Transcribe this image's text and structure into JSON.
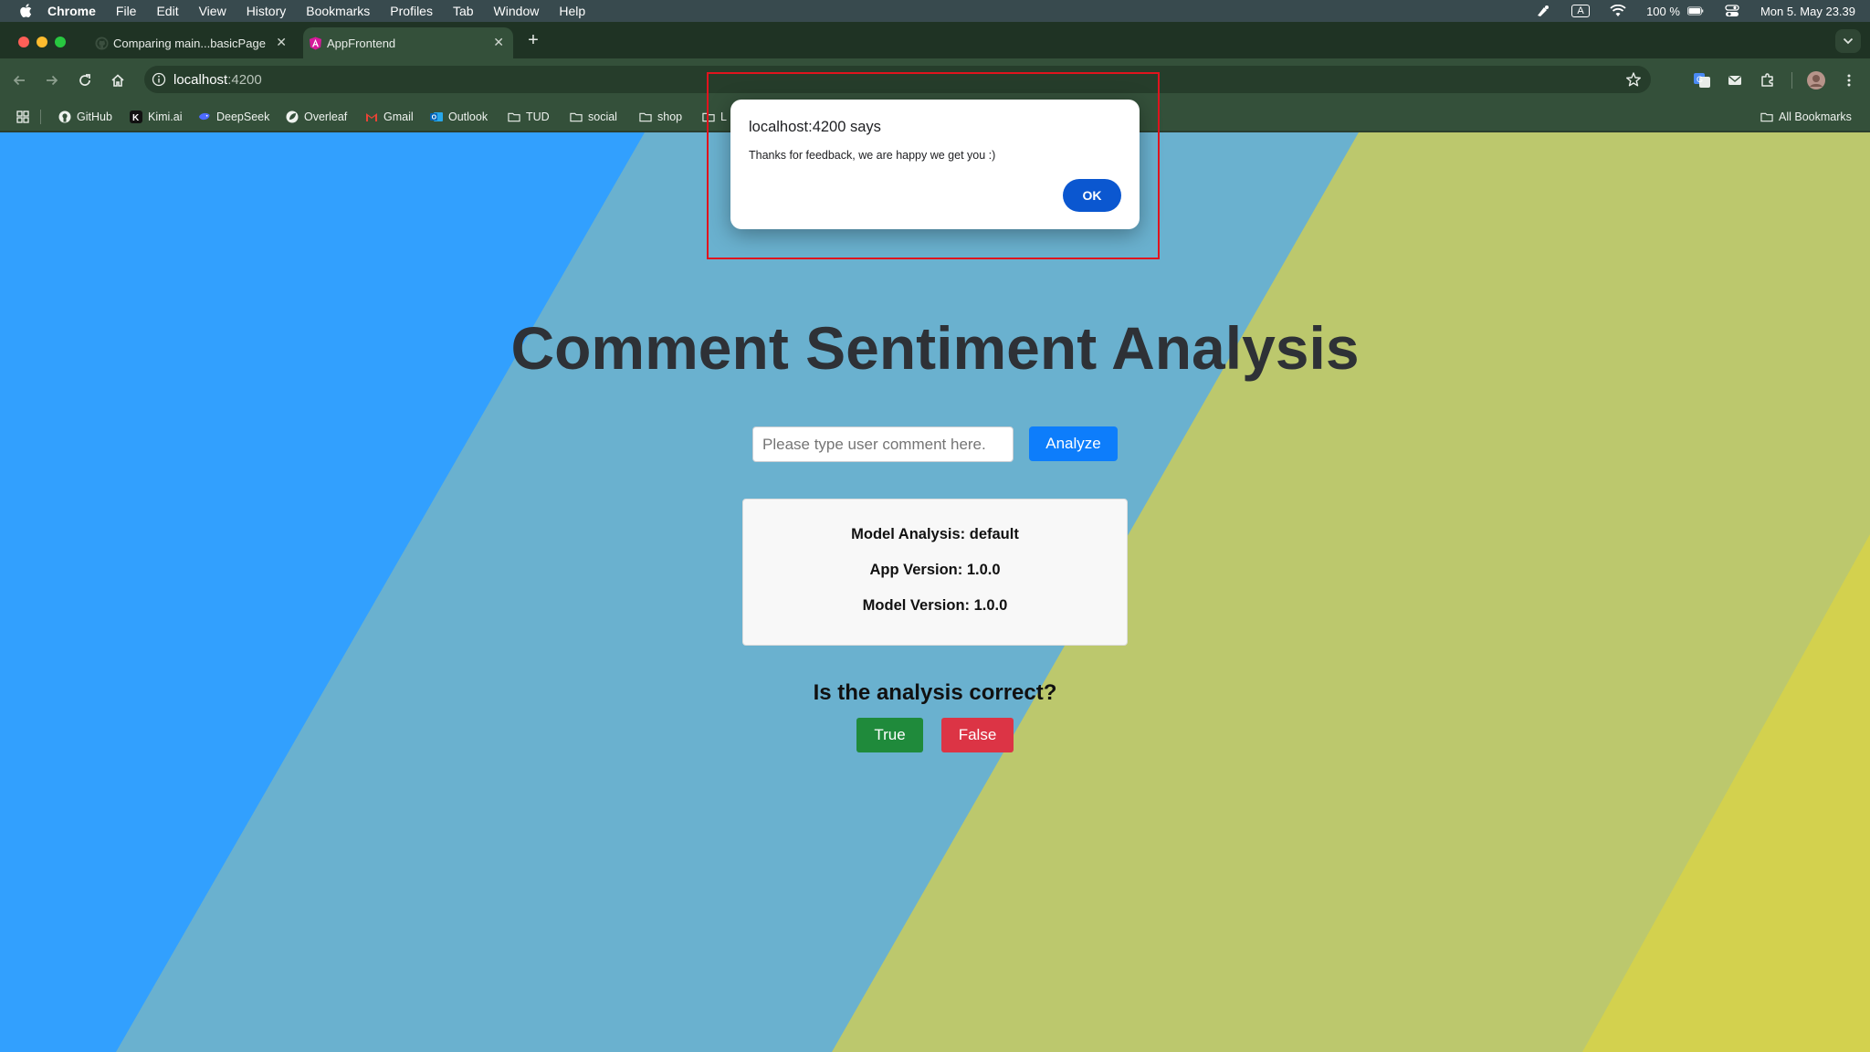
{
  "os_menubar": {
    "app": "Chrome",
    "items": [
      "File",
      "Edit",
      "View",
      "History",
      "Bookmarks",
      "Profiles",
      "Tab",
      "Window",
      "Help"
    ],
    "battery": "100 %",
    "clock": "Mon 5. May  23.39",
    "input_indicator": "A"
  },
  "browser": {
    "tabs": [
      {
        "title": "Comparing main...basicPage",
        "active": false
      },
      {
        "title": "AppFrontend",
        "active": true
      }
    ],
    "url_host": "localhost",
    "url_port": ":4200",
    "bookmarks": [
      "GitHub",
      "Kimi.ai",
      "DeepSeek",
      "Overleaf",
      "Gmail",
      "Outlook",
      "TUD",
      "social",
      "shop",
      "L"
    ],
    "all_bookmarks_label": "All Bookmarks"
  },
  "page": {
    "title": "Comment Sentiment Analysis",
    "input_placeholder": "Please type user comment here.",
    "input_value": "",
    "analyze_label": "Analyze",
    "result": {
      "model_analysis": "Model Analysis: default",
      "app_version": "App Version: 1.0.0",
      "model_version": "Model Version: 1.0.0"
    },
    "feedback_question": "Is the analysis correct?",
    "true_label": "True",
    "false_label": "False"
  },
  "alert": {
    "title": "localhost:4200 says",
    "message": "Thanks for feedback, we are happy we get you :)",
    "ok_label": "OK"
  },
  "colors": {
    "bg_blue": "#32a0fe",
    "bg_teal": "#6ab1cf",
    "bg_olive": "#bcc86d",
    "bg_yellow": "#d3d14e",
    "analyze_blue": "#0d7dfb",
    "true_green": "#1f8a3b",
    "false_red": "#dc3445",
    "ok_blue": "#0b57d0",
    "highlight_red": "#e0141e"
  }
}
